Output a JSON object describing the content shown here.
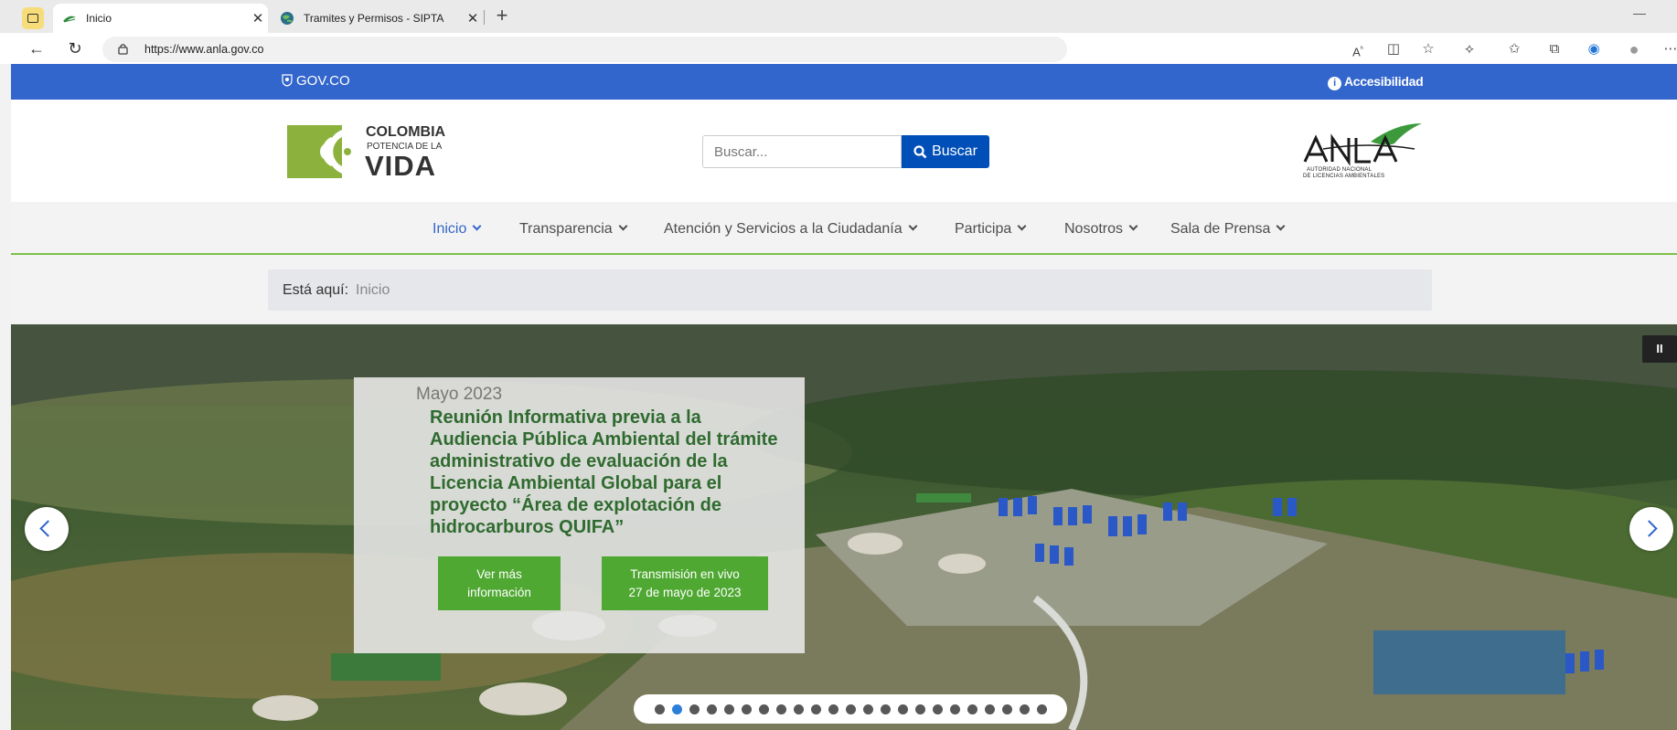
{
  "browser": {
    "tabs": [
      {
        "title": "Inicio",
        "active": true
      },
      {
        "title": "Tramites y Permisos - SIPTA",
        "active": false
      }
    ],
    "url": "https://www.anla.gov.co",
    "window_minimize": "—"
  },
  "govbar": {
    "govco_label": "GOV.CO",
    "accessibility_label": "Accesibilidad",
    "accessibility_icon_glyph": "i",
    "color": "#3366cc"
  },
  "header": {
    "logo": {
      "line1": "COLOMBIA",
      "line2": "POTENCIA DE LA",
      "line3": "VIDA"
    },
    "search": {
      "placeholder": "Buscar...",
      "button_label": "Buscar"
    },
    "anla_logo": {
      "line1": "AUTORIDAD NACIONAL",
      "line2": "DE LICENCIAS AMBIENTALES"
    }
  },
  "menu": {
    "items": [
      {
        "label": "Inicio",
        "active": true
      },
      {
        "label": "Transparencia",
        "active": false
      },
      {
        "label": "Atención y Servicios a la Ciudadanía",
        "active": false
      },
      {
        "label": "Participa",
        "active": false
      },
      {
        "label": "Nosotros",
        "active": false
      },
      {
        "label": "Sala de Prensa",
        "active": false
      }
    ]
  },
  "breadcrumb": {
    "label": "Está aquí:",
    "current": "Inicio"
  },
  "hero": {
    "date": "Mayo 2023",
    "headline": "Reunión Informativa previa a la Audiencia Pública Ambiental del trámite administrativo de evaluación de la Licencia Ambiental Global para el proyecto “Área de explotación de hidrocarburos QUIFA”",
    "button1": {
      "line1": "Ver más",
      "line2": "información"
    },
    "button2": {
      "line1": "Transmisión en vivo",
      "line2": "27 de mayo de 2023"
    },
    "pause_label": "II",
    "slide_count": 23,
    "active_slide": 2,
    "accent_green": "#4fa832"
  }
}
